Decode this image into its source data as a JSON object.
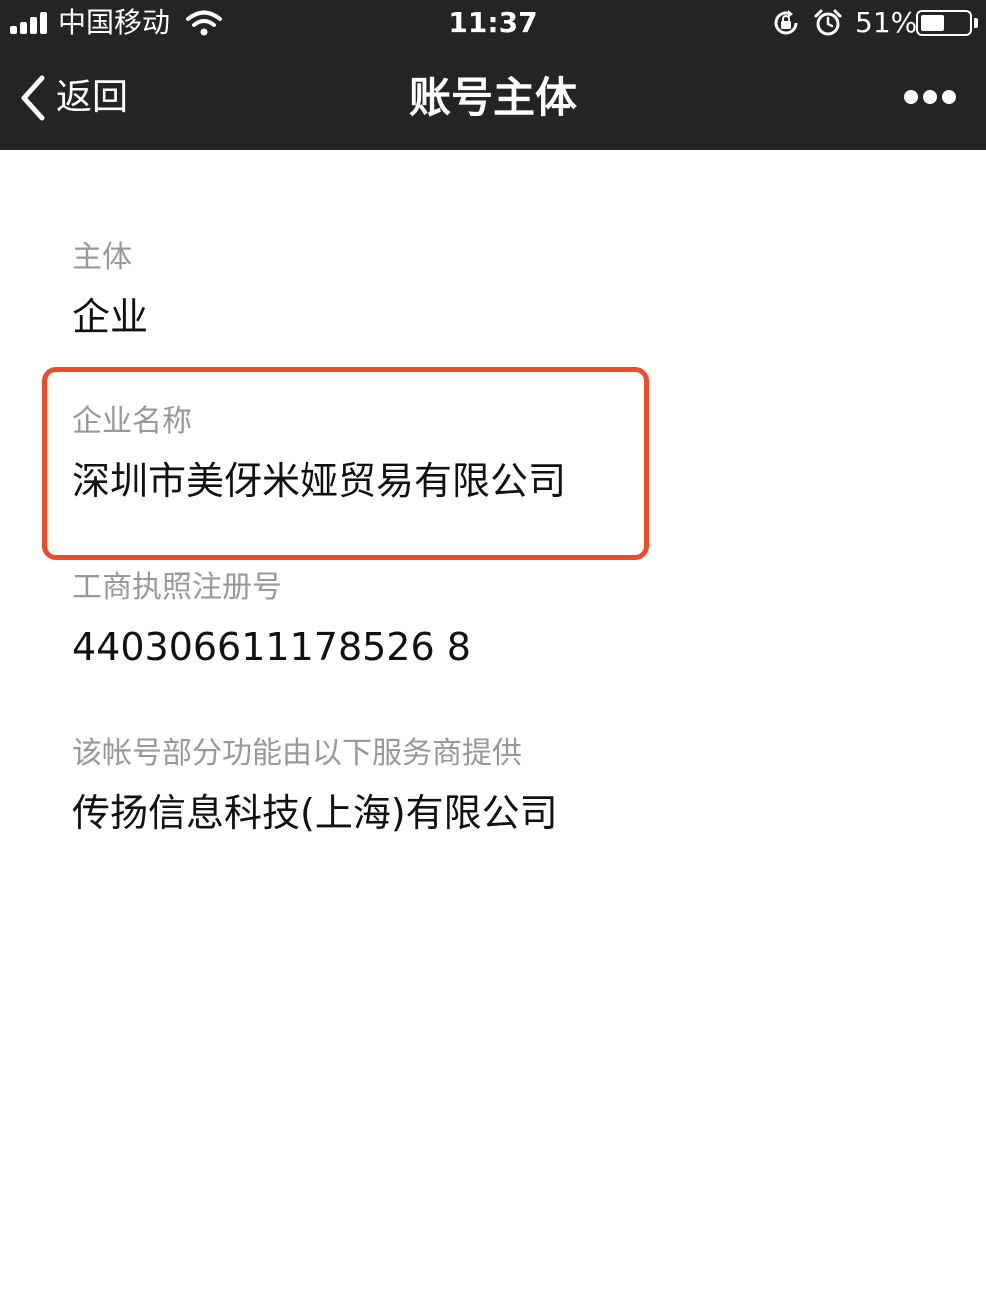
{
  "status_bar": {
    "carrier": "中国移动",
    "time": "11:37",
    "battery_percent": "51%",
    "battery_level": 0.51,
    "icons": [
      "signal-icon",
      "wifi-icon",
      "rotation-lock-icon",
      "alarm-icon",
      "battery-icon"
    ]
  },
  "nav": {
    "back_label": "返回",
    "title": "账号主体",
    "icons": [
      "chevron-left-icon",
      "more-icon"
    ]
  },
  "fields": [
    {
      "label": "主体",
      "value": "企业"
    },
    {
      "label": "企业名称",
      "value": "深圳市美伢米娅贸易有限公司"
    },
    {
      "label": "工商执照注册号",
      "value": "440306611178526 8"
    },
    {
      "label": "该帐号部分功能由以下服务商提供",
      "value": "传扬信息科技(上海)有限公司"
    }
  ],
  "colors": {
    "header_bg": "#242424",
    "label": "#999999",
    "value": "#111111",
    "highlight": "#ee4b2b"
  }
}
